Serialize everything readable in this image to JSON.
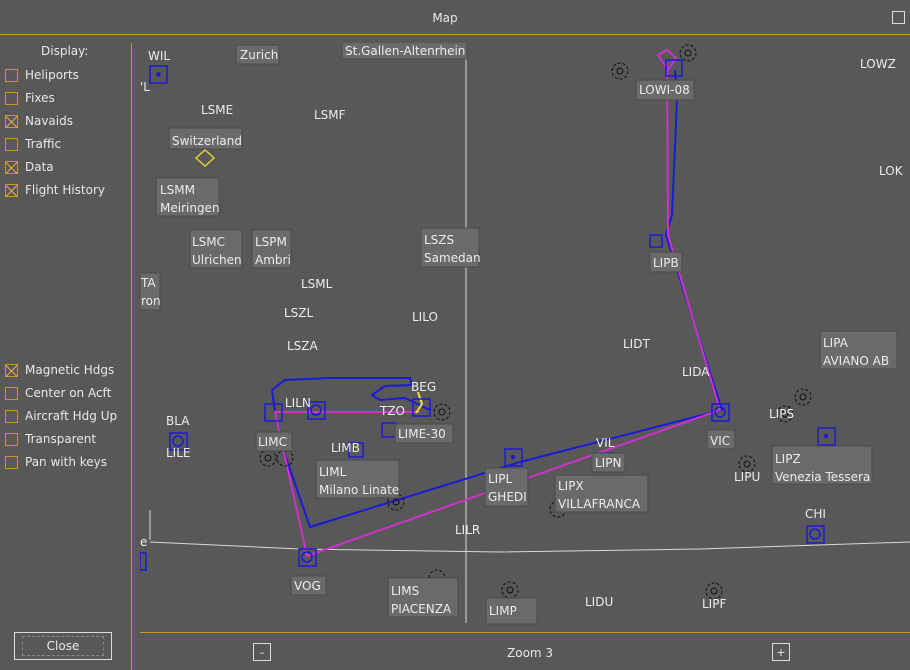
{
  "window": {
    "title": "Map"
  },
  "display": {
    "label": "Display:",
    "options": [
      {
        "label": "Heliports",
        "checked": false
      },
      {
        "label": "Fixes",
        "checked": false
      },
      {
        "label": "Navaids",
        "checked": true
      },
      {
        "label": "Traffic",
        "checked": false
      },
      {
        "label": "Data",
        "checked": true
      },
      {
        "label": "Flight History",
        "checked": true
      }
    ],
    "options2": [
      {
        "label": "Magnetic Hdgs",
        "checked": true
      },
      {
        "label": "Center on Acft",
        "checked": false
      },
      {
        "label": "Aircraft Hdg Up",
        "checked": false
      },
      {
        "label": "Transparent",
        "checked": false
      },
      {
        "label": "Pan with keys",
        "checked": false
      }
    ]
  },
  "buttons": {
    "close": "Close",
    "zoom_out": "–",
    "zoom_in": "+"
  },
  "zoom": {
    "label": "Zoom 3"
  },
  "colors": {
    "accent": "#c8962a",
    "route": "#cc33cc",
    "history": "#1a1ad6",
    "background": "#585858"
  },
  "map": {
    "boxed_labels": [
      {
        "l1": "Zurich",
        "l2": ""
      },
      {
        "l1": "St.Gallen-Altenrhein",
        "l2": ""
      },
      {
        "l1": "Switzerland",
        "l2": ""
      },
      {
        "l1": "LSMM",
        "l2": "Meiringen"
      },
      {
        "l1": "LSMC",
        "l2": "Ulrichen"
      },
      {
        "l1": "LSPM",
        "l2": "Ambri"
      },
      {
        "l1": "LSZS",
        "l2": "Samedan"
      },
      {
        "l1": "TA",
        "l2": "ron"
      },
      {
        "l1": "LOWI-08",
        "l2": ""
      },
      {
        "l1": "LIPB",
        "l2": ""
      },
      {
        "l1": "LIPA",
        "l2": "AVIANO AB"
      },
      {
        "l1": "LIMC",
        "l2": ""
      },
      {
        "l1": "LIME-30",
        "l2": ""
      },
      {
        "l1": "LIML",
        "l2": "Milano Linate"
      },
      {
        "l1": "LIPL",
        "l2": "GHEDI"
      },
      {
        "l1": "LIPN",
        "l2": ""
      },
      {
        "l1": "LIPX",
        "l2": "VILLAFRANCA"
      },
      {
        "l1": "VIC",
        "l2": ""
      },
      {
        "l1": "LIPZ",
        "l2": "Venezia Tessera"
      },
      {
        "l1": "VOG",
        "l2": ""
      },
      {
        "l1": "LIMS",
        "l2": "PIACENZA"
      },
      {
        "l1": "LIMP",
        "l2": ""
      }
    ],
    "plain_labels": [
      "WIL",
      "'L",
      "LSME",
      "LSMF",
      "LOWZ",
      "LOK",
      "LSML",
      "LSZL",
      "LILO",
      "LSZA",
      "LIDT",
      "LIDA",
      "BEG",
      "LILN",
      "TZO",
      "BLA",
      "LILE",
      "LIMB",
      "VIL",
      "LIPS",
      "LIPU",
      "CHI",
      "LILR",
      "LIDU",
      "LIPF",
      "e"
    ]
  }
}
